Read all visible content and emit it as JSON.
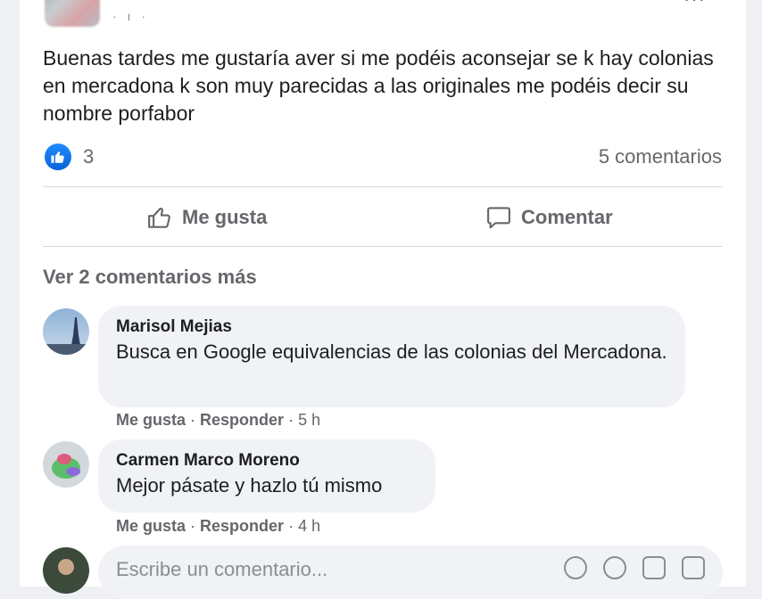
{
  "post": {
    "text": "Buenas tardes me gustaría aver si me podéis aconsejar se k hay colonias en mercadona k son muy parecidas a las originales me podéis decir su nombre porfabor",
    "meta": "· ı ·",
    "more_icon": "···",
    "reaction_count": "3",
    "comments_count": "5 comentarios"
  },
  "actions": {
    "like_label": "Me gusta",
    "comment_label": "Comentar"
  },
  "comments_section": {
    "more_comments": "Ver 2 comentarios más",
    "comments": [
      {
        "author": "Marisol Mejias",
        "text": "Busca en Google equivalencias de las colonias del Mercadona.",
        "like": "Me gusta",
        "reply": "Responder",
        "time": "5 h"
      },
      {
        "author": "Carmen Marco Moreno",
        "text": "Mejor pásate y hazlo tú mismo",
        "like": "Me gusta",
        "reply": "Responder",
        "time": "4 h"
      }
    ],
    "write_placeholder": "Escribe un comentario..."
  },
  "colors": {
    "like_blue": "#1877f2",
    "muted_text": "#65676b",
    "bubble_bg": "#f0f2f5"
  }
}
